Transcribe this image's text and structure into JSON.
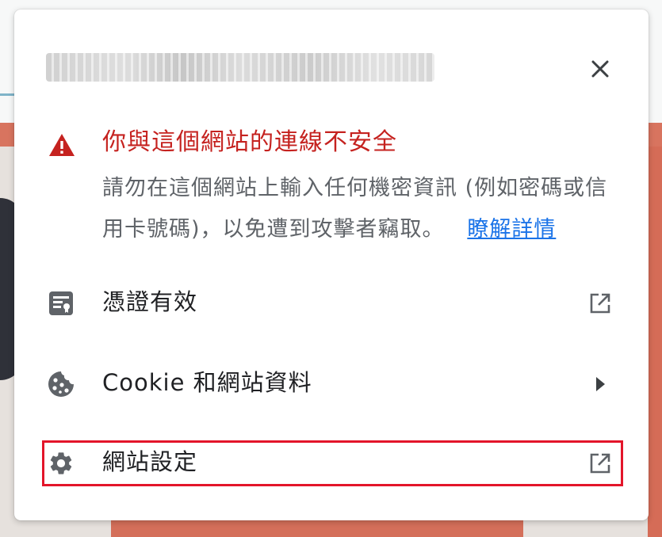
{
  "popup": {
    "url_blurred": true,
    "close_icon": "close-icon",
    "warning": {
      "icon": "warning-triangle-icon",
      "title": "你與這個網站的連線不安全",
      "body": "請勿在這個網站上輸入任何機密資訊 (例如密碼或信用卡號碼)，以免遭到攻擊者竊取。",
      "learn_more": "瞭解詳情",
      "title_color": "#c5221f",
      "link_color": "#1a73e8"
    },
    "items": [
      {
        "label": "憑證有效",
        "icon": "certificate-icon",
        "trailing_icon": "open-in-new-icon"
      },
      {
        "label": "Cookie 和網站資料",
        "icon": "cookie-icon",
        "trailing_icon": "arrow-right-icon"
      },
      {
        "label": "網站設定",
        "icon": "gear-icon",
        "trailing_icon": "open-in-new-icon",
        "highlighted": true
      }
    ],
    "highlight_color": "#e3152a"
  }
}
